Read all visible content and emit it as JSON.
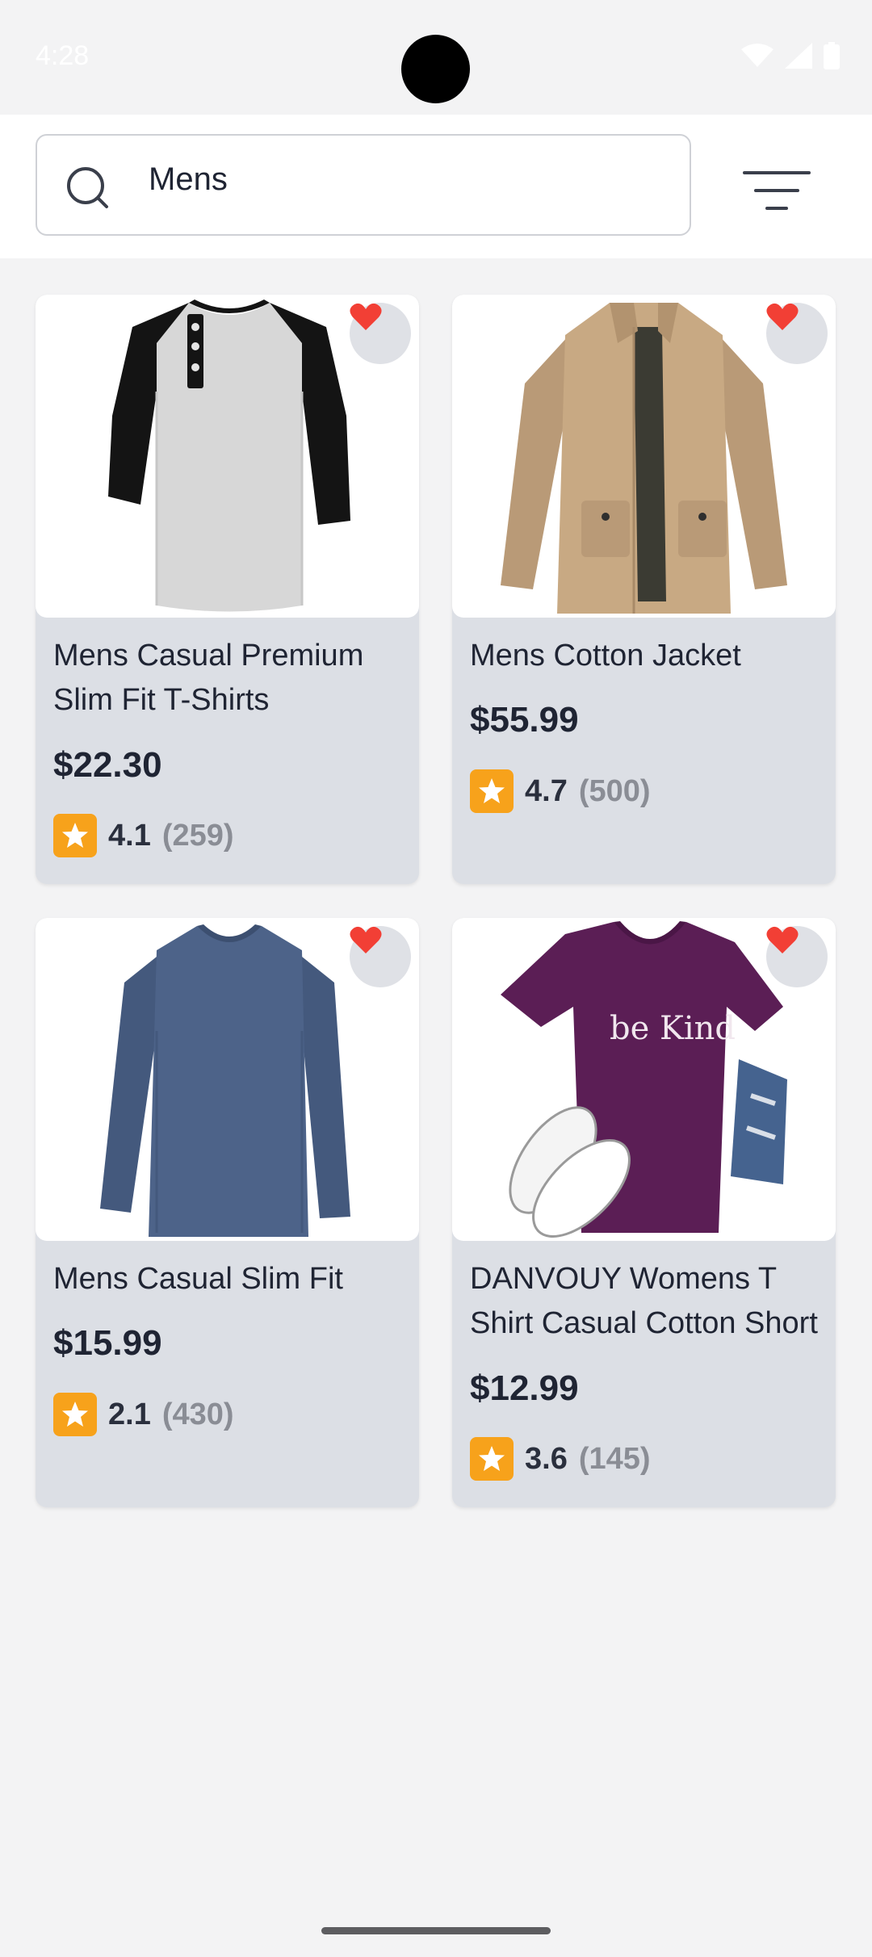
{
  "status_bar": {
    "time": "4:28"
  },
  "search": {
    "value": "Mens",
    "placeholder": ""
  },
  "colors": {
    "background": "#f3f3f4",
    "card": "#dcdfe5",
    "heart": "#f23f35",
    "star_badge": "#f7a21b"
  },
  "products": [
    {
      "title": "Mens Casual Premium Slim Fit T-Shirts",
      "price": "$22.30",
      "rating": "4.1",
      "reviews": "(259)",
      "image_icon": "raglan-tshirt-image"
    },
    {
      "title": "Mens Cotton Jacket",
      "price": "$55.99",
      "rating": "4.7",
      "reviews": "(500)",
      "image_icon": "cotton-jacket-image"
    },
    {
      "title": "Mens Casual Slim Fit",
      "price": "$15.99",
      "rating": "2.1",
      "reviews": "(430)",
      "image_icon": "long-sleeve-shirt-image"
    },
    {
      "title": "DANVOUY Womens T Shirt Casual Cotton Short",
      "price": "$12.99",
      "rating": "3.6",
      "reviews": "(145)",
      "image_icon": "be-kind-tshirt-image",
      "image_text": "be Kind"
    }
  ]
}
